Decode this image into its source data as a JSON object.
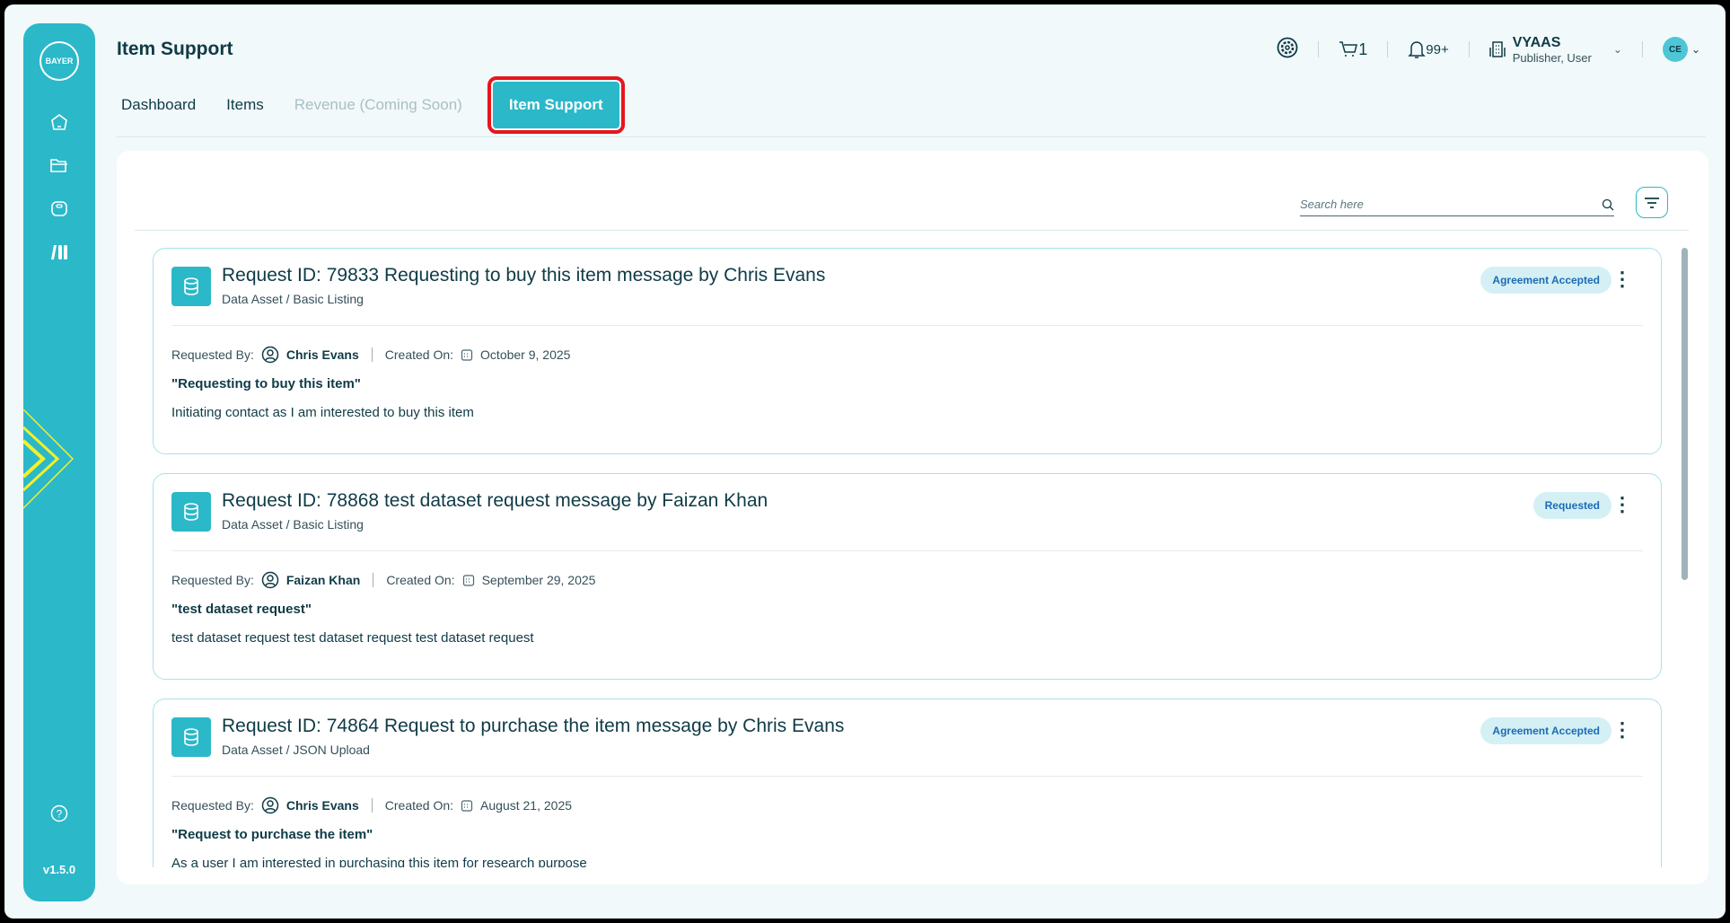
{
  "header": {
    "title": "Item Support",
    "cart_count": "1",
    "notif_count": "99+",
    "org_name": "VYAAS",
    "org_roles": "Publisher, User",
    "avatar_initials": "CE"
  },
  "sidebar": {
    "logo": "BAYER",
    "version": "v1.5.0"
  },
  "tabs": [
    {
      "label": "Dashboard"
    },
    {
      "label": "Items"
    },
    {
      "label": "Revenue (Coming Soon)"
    },
    {
      "label": "Item Support"
    }
  ],
  "search": {
    "placeholder": "Search here"
  },
  "labels": {
    "requested_by": "Requested By:",
    "created_on": "Created On:"
  },
  "requests": [
    {
      "title": "Request ID: 79833 Requesting to buy this item message by Chris Evans",
      "category": "Data Asset / Basic Listing",
      "status": "Agreement Accepted",
      "requester": "Chris Evans",
      "created": "October 9, 2025",
      "subject": "\"Requesting to buy this item\"",
      "message": "Initiating contact as I am interested to buy this item"
    },
    {
      "title": "Request ID: 78868 test dataset request message by Faizan Khan",
      "category": "Data Asset / Basic Listing",
      "status": "Requested",
      "requester": "Faizan Khan",
      "created": "September 29, 2025",
      "subject": "\"test dataset request\"",
      "message": "test dataset request test dataset request test dataset request"
    },
    {
      "title": "Request ID: 74864 Request to purchase the item message by Chris Evans",
      "category": "Data Asset / JSON Upload",
      "status": "Agreement Accepted",
      "requester": "Chris Evans",
      "created": "August 21, 2025",
      "subject": "\"Request to purchase the item\"",
      "message": "As a user I am interested in purchasing this item for research purpose"
    }
  ]
}
